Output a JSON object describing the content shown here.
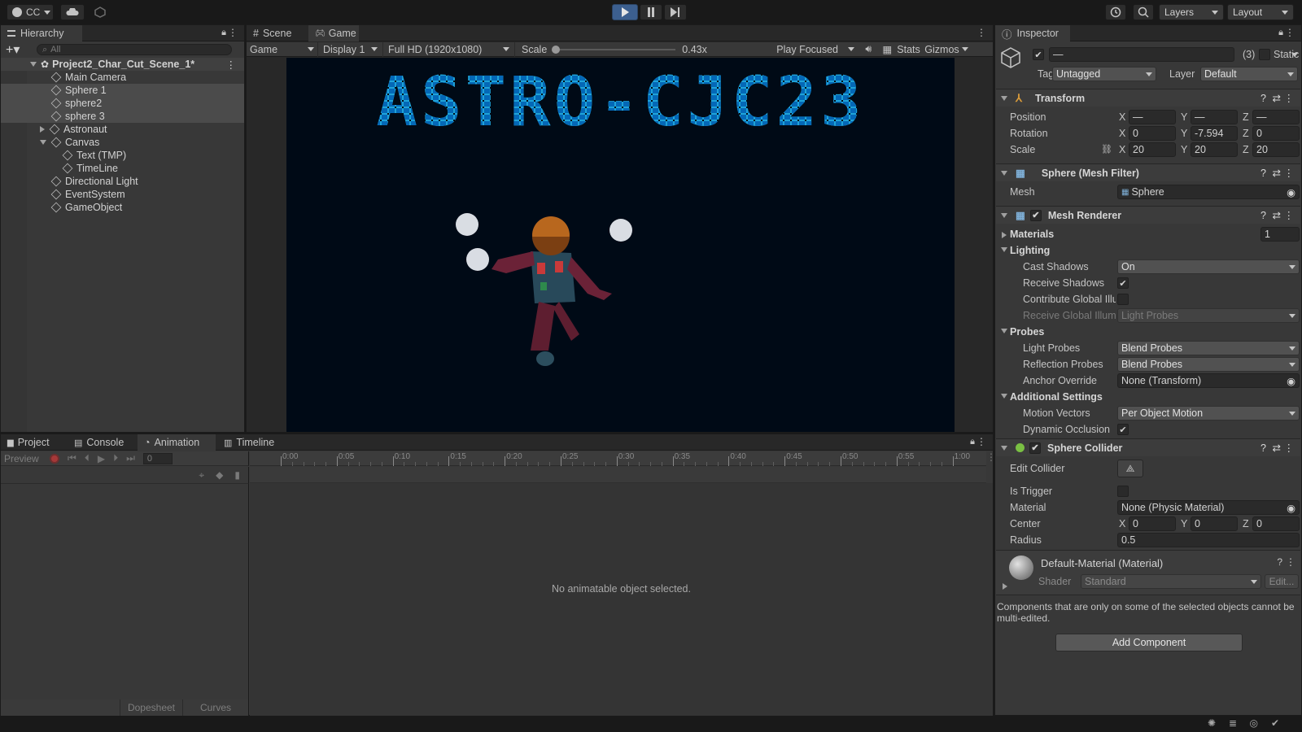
{
  "toolbar": {
    "account": "CC",
    "layers": "Layers",
    "layout": "Layout"
  },
  "hierarchy": {
    "title": "Hierarchy",
    "search_placeholder": "All",
    "scene": "Project2_Char_Cut_Scene_1*",
    "items": [
      "Main Camera",
      "Sphere 1",
      "sphere2",
      "sphere 3",
      "Astronaut",
      "Canvas",
      "Text (TMP)",
      "TimeLine",
      "Directional Light",
      "EventSystem",
      "GameObject"
    ]
  },
  "game": {
    "tabs": [
      "Scene",
      "Game"
    ],
    "mode": "Game",
    "display": "Display 1",
    "resolution": "Full HD (1920x1080)",
    "scale_label": "Scale",
    "scale_value": "0.43x",
    "play_mode": "Play Focused",
    "stats": "Stats",
    "gizmos": "Gizmos",
    "title_text": "ASTRO-CJC23"
  },
  "bottom": {
    "tabs": [
      "Project",
      "Console",
      "Animation",
      "Timeline"
    ],
    "preview": "Preview",
    "frame": "0",
    "ticks": [
      "0:00",
      "0:05",
      "0:10",
      "0:15",
      "0:20",
      "0:25",
      "0:30",
      "0:35",
      "0:40",
      "0:45",
      "0:50",
      "0:55",
      "1:00"
    ],
    "empty_msg": "No animatable object selected.",
    "dopesheet": "Dopesheet",
    "curves": "Curves"
  },
  "inspector": {
    "title": "Inspector",
    "name_value": "—",
    "count": "(3)",
    "static": "Static",
    "tag_label": "Tag",
    "tag": "Untagged",
    "layer_label": "Layer",
    "layer": "Default",
    "transform": {
      "title": "Transform",
      "position_label": "Position",
      "rotation_label": "Rotation",
      "scale_label": "Scale",
      "px": "—",
      "py": "—",
      "pz": "—",
      "rx": "0",
      "ry": "-7.594",
      "rz": "0",
      "sx": "20",
      "sy": "20",
      "sz": "20"
    },
    "mesh_filter": {
      "title": "Sphere (Mesh Filter)",
      "mesh_label": "Mesh",
      "mesh": "Sphere"
    },
    "mesh_renderer": {
      "title": "Mesh Renderer",
      "materials": "Materials",
      "materials_count": "1",
      "lighting": "Lighting",
      "cast_shadows_label": "Cast Shadows",
      "cast_shadows": "On",
      "receive_shadows": "Receive Shadows",
      "contribute_gi": "Contribute Global Illu",
      "receive_gi_label": "Receive Global Illum",
      "receive_gi": "Light Probes",
      "probes": "Probes",
      "light_probes_label": "Light Probes",
      "light_probes": "Blend Probes",
      "reflection_probes_label": "Reflection Probes",
      "reflection_probes": "Blend Probes",
      "anchor_label": "Anchor Override",
      "anchor": "None (Transform)",
      "additional": "Additional Settings",
      "motion_vectors_label": "Motion Vectors",
      "motion_vectors": "Per Object Motion",
      "dynamic_occlusion": "Dynamic Occlusion"
    },
    "collider": {
      "title": "Sphere Collider",
      "edit_label": "Edit Collider",
      "trigger_label": "Is Trigger",
      "material_label": "Material",
      "material": "None (Physic Material)",
      "center_label": "Center",
      "cx": "0",
      "cy": "0",
      "cz": "0",
      "radius_label": "Radius",
      "radius": "0.5"
    },
    "material": {
      "name": "Default-Material (Material)",
      "shader_label": "Shader",
      "shader": "Standard",
      "edit": "Edit..."
    },
    "note": "Components that are only on some of the selected objects cannot be multi-edited.",
    "add_component": "Add Component"
  }
}
